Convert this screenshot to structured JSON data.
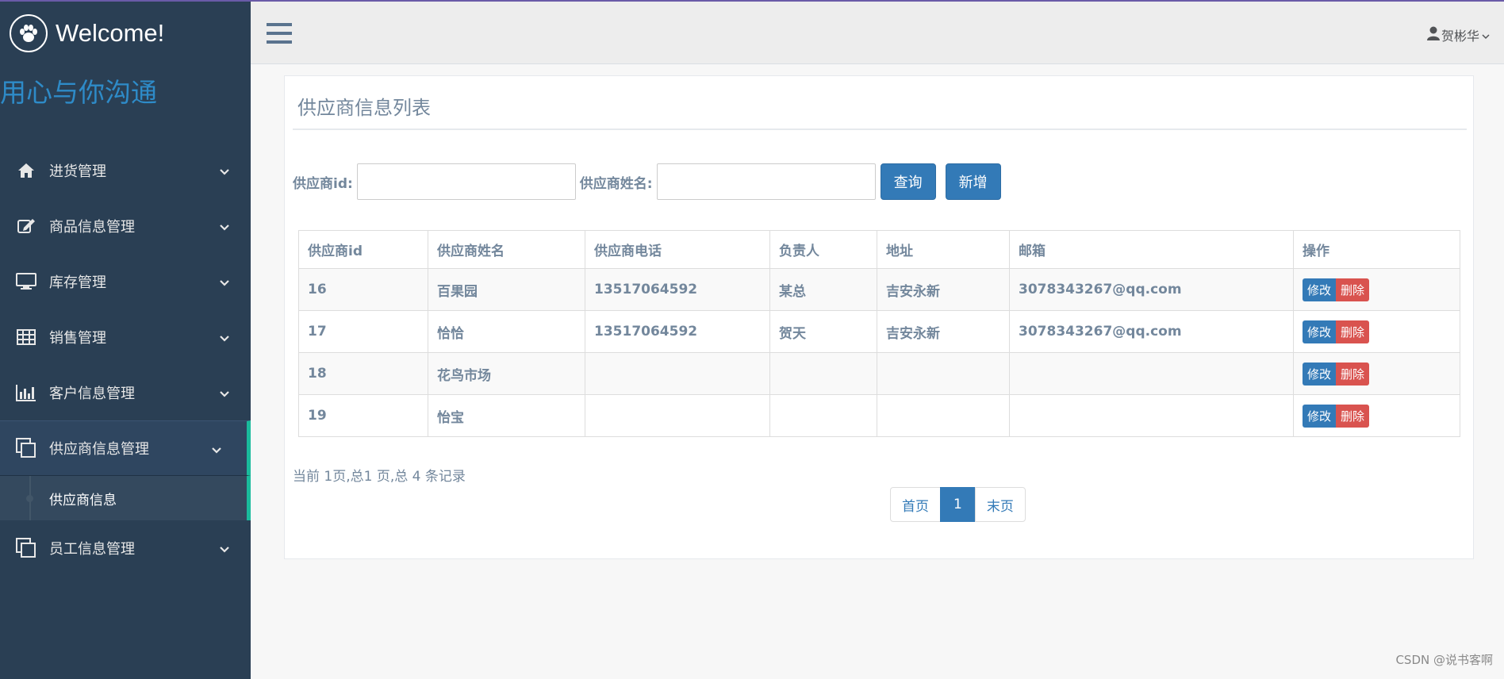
{
  "brand": {
    "title": "Welcome!",
    "slogan": "用心与你沟通"
  },
  "sidebar": {
    "items": [
      {
        "label": "进货管理",
        "icon": "home-icon"
      },
      {
        "label": "商品信息管理",
        "icon": "edit-icon"
      },
      {
        "label": "库存管理",
        "icon": "desktop-icon"
      },
      {
        "label": "销售管理",
        "icon": "table-icon"
      },
      {
        "label": "客户信息管理",
        "icon": "bar-chart-icon"
      },
      {
        "label": "供应商信息管理",
        "icon": "clone-icon",
        "active": true
      },
      {
        "label": "员工信息管理",
        "icon": "clone-icon"
      }
    ],
    "submenu": {
      "label": "供应商信息"
    }
  },
  "topnav": {
    "user": "贺彬华"
  },
  "panel": {
    "title": "供应商信息列表"
  },
  "search": {
    "id_label": "供应商id:",
    "name_label": "供应商姓名:",
    "id_value": "",
    "name_value": "",
    "query_button": "查询",
    "add_button": "新增"
  },
  "table": {
    "headers": [
      "供应商id",
      "供应商姓名",
      "供应商电话",
      "负责人",
      "地址",
      "邮箱",
      "操作"
    ],
    "rows": [
      [
        "16",
        "百果园",
        "13517064592",
        "某总",
        "吉安永新",
        "3078343267@qq.com"
      ],
      [
        "17",
        "恰恰",
        "13517064592",
        "贺天",
        "吉安永新",
        "3078343267@qq.com"
      ],
      [
        "18",
        "花鸟市场",
        "",
        "",
        "",
        ""
      ],
      [
        "19",
        "怡宝",
        "",
        "",
        "",
        ""
      ]
    ],
    "edit_label": "修改",
    "delete_label": "删除"
  },
  "footer": {
    "page_info": "当前 1页,总1 页,总 4 条记录",
    "first": "首页",
    "current": "1",
    "last": "末页"
  },
  "watermark": "CSDN @说书客啊",
  "colors": {
    "sidebar": "#2a3f54",
    "accent": "#1abb9c",
    "primary": "#337ab7",
    "danger": "#d9534f"
  }
}
